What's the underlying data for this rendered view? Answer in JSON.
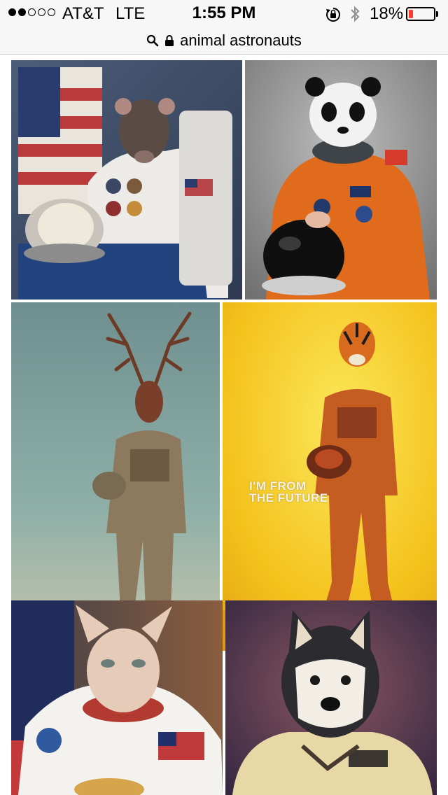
{
  "status_bar": {
    "signal_filled": 2,
    "signal_total": 5,
    "carrier": "AT&T",
    "network": "LTE",
    "time": "1:55 PM",
    "battery_percent": "18%",
    "battery_level": 0.18,
    "battery_color": "#ff3b30"
  },
  "browser": {
    "icons": [
      "search-icon",
      "lock-icon"
    ],
    "url_text": "animal astronauts"
  },
  "results": {
    "images": [
      {
        "subject": "rat astronaut",
        "icon": "rat-astronaut-image"
      },
      {
        "subject": "panda astronaut",
        "icon": "panda-astronaut-image"
      },
      {
        "subject": "stag astronaut",
        "icon": "stag-astronaut-image"
      },
      {
        "subject": "tiger astronaut",
        "icon": "tiger-astronaut-image",
        "caption_lines": [
          "I'M FROM",
          "THE FUTURE"
        ]
      },
      {
        "subject": "sphynx cat astronaut",
        "icon": "cat-astronaut-image"
      },
      {
        "subject": "husky astronaut",
        "icon": "husky-astronaut-image"
      }
    ]
  }
}
